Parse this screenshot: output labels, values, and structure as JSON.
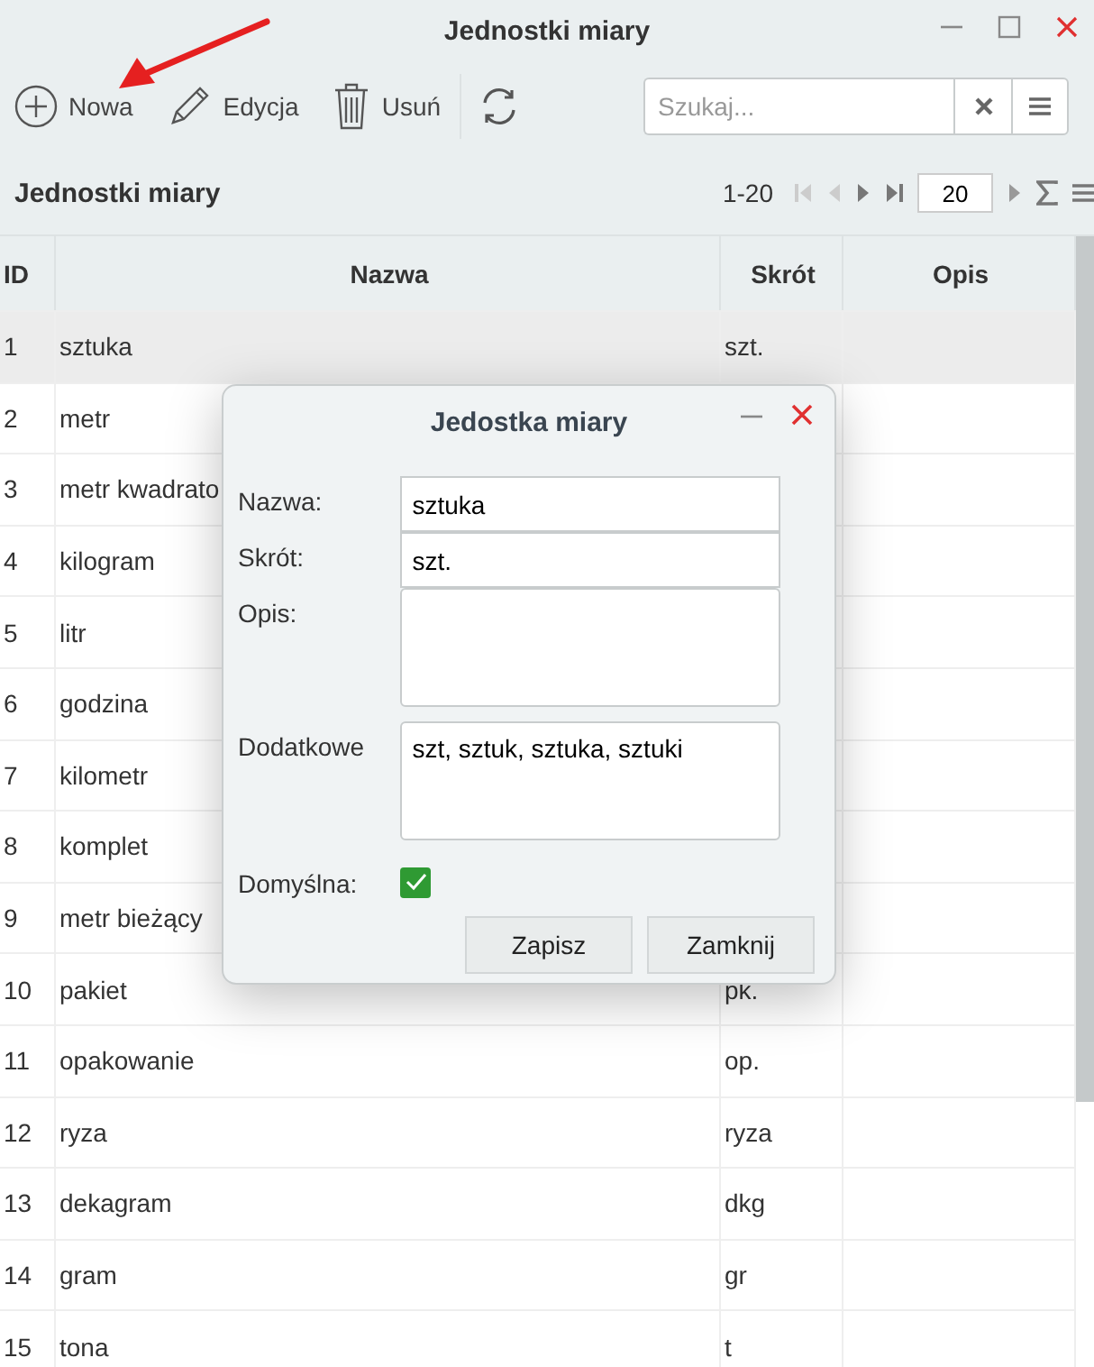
{
  "window": {
    "title": "Jednostki miary"
  },
  "toolbar": [
    {
      "kind": "plus",
      "label": "Nowa"
    },
    {
      "kind": "pencil",
      "label": "Edycja"
    },
    {
      "kind": "trash",
      "label": "Usuń"
    },
    {
      "kind": "refresh"
    }
  ],
  "search": {
    "placeholder": "Szukaj..."
  },
  "grid": {
    "title": "Jednostki miary",
    "range": "1-20",
    "page_size": "20"
  },
  "table": {
    "columns": [
      "ID",
      "Nazwa",
      "Skrót",
      "Opis"
    ],
    "rows": [
      {
        "id": "1",
        "name": "sztuka",
        "short": "szt.",
        "selected": true
      },
      {
        "id": "2",
        "name": "metr",
        "selected": false
      },
      {
        "id": "3",
        "name": "metr kwadrato",
        "selected": false
      },
      {
        "id": "4",
        "name": "kilogram",
        "selected": false
      },
      {
        "id": "5",
        "name": "litr",
        "selected": false
      },
      {
        "id": "6",
        "name": "godzina",
        "selected": false
      },
      {
        "id": "7",
        "name": "kilometr",
        "selected": false
      },
      {
        "id": "8",
        "name": "komplet",
        "selected": false
      },
      {
        "id": "9",
        "name": "metr bieżący",
        "selected": false
      },
      {
        "id": "10",
        "name": "pakiet",
        "short": "pk.",
        "selected": false
      },
      {
        "id": "11",
        "name": "opakowanie",
        "short": "op.",
        "selected": false
      },
      {
        "id": "12",
        "name": "ryza",
        "short": "ryza",
        "selected": false
      },
      {
        "id": "13",
        "name": "dekagram",
        "short": "dkg",
        "selected": false
      },
      {
        "id": "14",
        "name": "gram",
        "short": "gr",
        "selected": false
      },
      {
        "id": "15",
        "name": "tona",
        "short": "t",
        "selected": false
      }
    ]
  },
  "dialog": {
    "title": "Jedostka miary",
    "fields": [
      {
        "kind": "text",
        "label": "Nazwa:",
        "value": "sztuka"
      },
      {
        "kind": "text",
        "label": "Skrót:",
        "value": "szt."
      },
      {
        "kind": "textarea",
        "label": "Opis:"
      },
      {
        "kind": "textarea",
        "label": "Dodatkowe",
        "value": "szt, sztuk, sztuka, sztuki"
      },
      {
        "kind": "checkbox",
        "label": "Domyślna:",
        "checked": true
      }
    ],
    "buttons": [
      "Zapisz",
      "Zamknij"
    ]
  }
}
